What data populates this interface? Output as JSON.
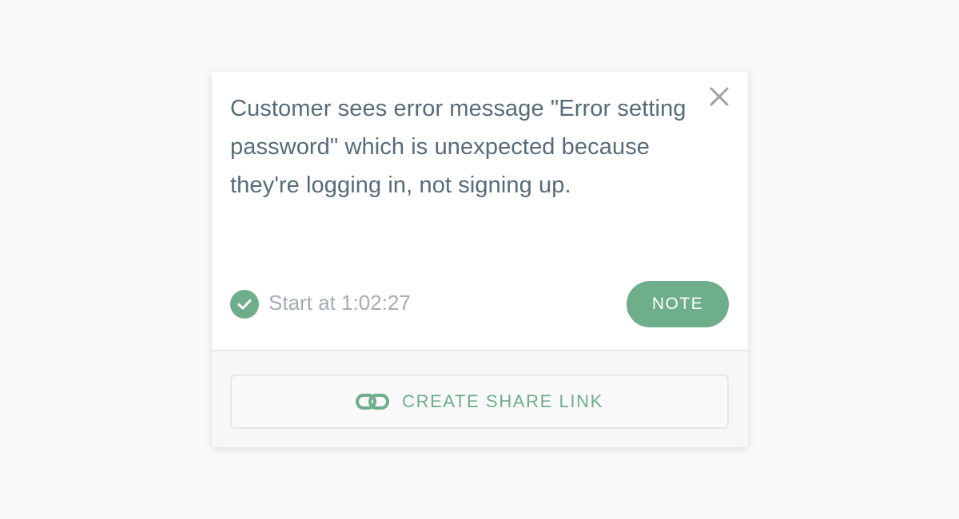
{
  "note": {
    "text": "Customer sees error message \"Error setting password\" which is unexpected because they're logging in, not signing up.",
    "start_label": "Start at 1:02:27",
    "note_button_label": "NOTE",
    "share_button_label": "CREATE SHARE LINK"
  },
  "icons": {
    "close": "close-icon",
    "check": "check-circle-icon",
    "link": "link-icon"
  },
  "colors": {
    "accent": "#6fae8a",
    "text": "#566b7a",
    "muted": "#a4acb1",
    "background": "#f9f9f9"
  }
}
